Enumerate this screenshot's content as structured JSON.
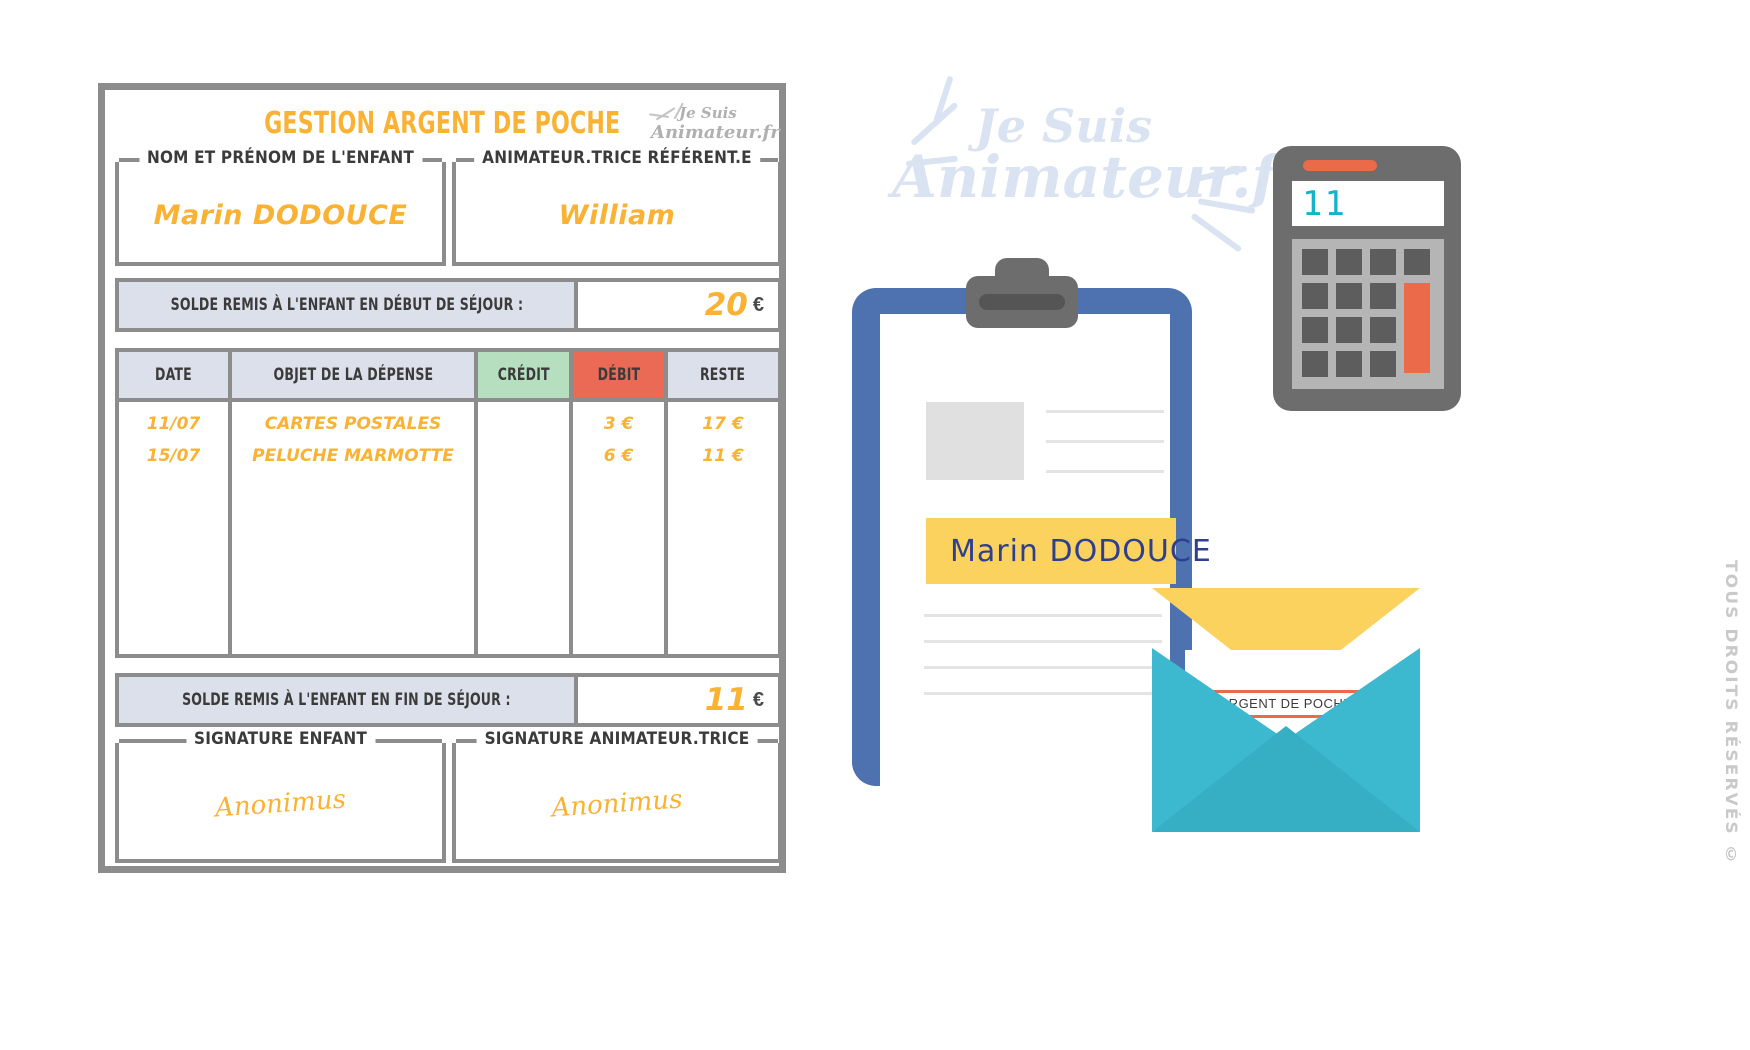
{
  "document": {
    "title": "GESTION ARGENT DE POCHE",
    "corner_logo": {
      "line1": "Je Suis",
      "line2": "Animateur.fr"
    },
    "fields": [
      {
        "label": "NOM ET PRÉNOM DE L'ENFANT",
        "value": "Marin DODOUCE"
      },
      {
        "label": "ANIMATEUR.TRICE RÉFÉRENT.E",
        "value": "William"
      }
    ],
    "balance_start": {
      "label": "SOLDE REMIS À L'ENFANT EN DÉBUT DE SÉJOUR :",
      "amount": "20",
      "currency": "€"
    },
    "balance_end": {
      "label": "SOLDE REMIS À L'ENFANT EN FIN DE SÉJOUR :",
      "amount": "11",
      "currency": "€"
    },
    "table": {
      "headers": [
        "DATE",
        "OBJET DE LA DÉPENSE",
        "CRÉDIT",
        "DÉBIT",
        "RESTE"
      ],
      "header_colors": {
        "date": "#dbe0ea",
        "objet": "#dbe0ea",
        "credit": "#b6dfbf",
        "debit": "#ea6a56",
        "reste": "#dbe0ea"
      },
      "rows": [
        {
          "date": "11/07",
          "objet": "CARTES POSTALES",
          "credit": "",
          "debit": "3 €",
          "reste": "17 €"
        },
        {
          "date": "15/07",
          "objet": "PELUCHE MARMOTTE",
          "credit": "",
          "debit": "6 €",
          "reste": "11 €"
        }
      ]
    },
    "signatures": [
      {
        "label": "SIGNATURE ENFANT",
        "mark": "Anonimus"
      },
      {
        "label": "SIGNATURE ANIMATEUR.TRICE",
        "mark": "Anonimus"
      }
    ]
  },
  "illustration": {
    "watermark": {
      "line1": "Je Suis",
      "line2": "Animateur.fr"
    },
    "calculator": {
      "display": "11",
      "accent_color": "#ea6a4a",
      "display_color": "#12b4c8"
    },
    "clipboard": {
      "name": "Marin DODOUCE",
      "highlight_color": "#FBD25D",
      "board_color": "#4e71b0"
    },
    "envelope": {
      "label": "ARGENT DE POCHE",
      "flap_color": "#FBD25D",
      "body_color": "#3cb8cf"
    }
  },
  "footer": {
    "rights": "TOUS DROITS RÉSERVÉS ©"
  },
  "colors": {
    "accent_yellow": "#F9B233",
    "border_grey": "#8c8c8c",
    "header_grey": "#dbe0ea"
  }
}
